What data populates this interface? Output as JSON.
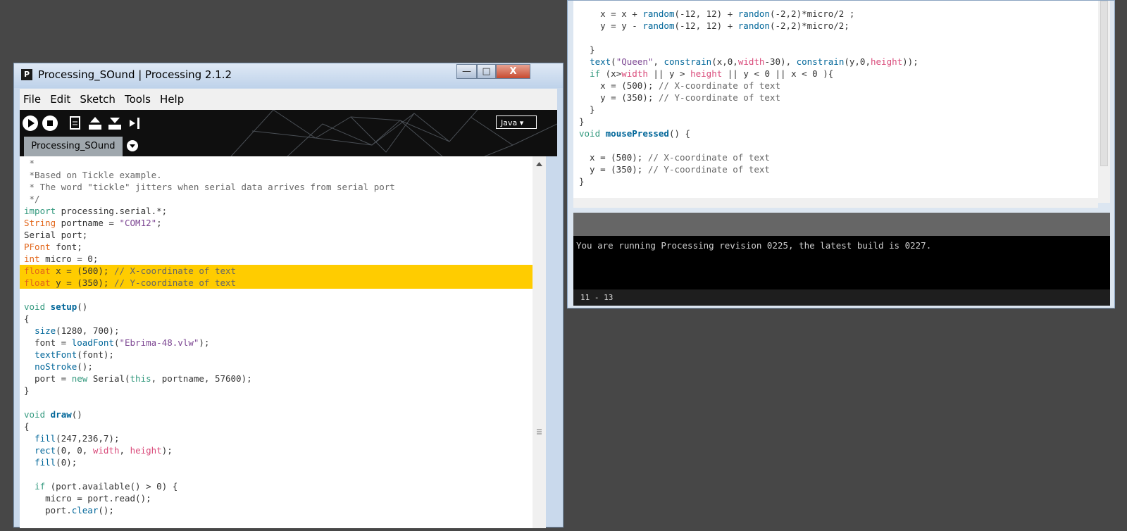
{
  "right_window": {
    "code_lines": [
      "    x = x + random(-12, 12) + randon(-2,2)*micro/2 ;",
      "    y = y - random(-12, 12) + randon(-2,2)*micro/2;",
      "",
      "  }",
      "  text(\"Queen\", constrain(x,0,width-30), constrain(y,0,height));",
      "  if (x>width || y > height || y < 0 || x < 0 ){",
      "    x = (500); // X-coordinate of text",
      "    y = (350); // Y-coordinate of text",
      "  }",
      "}",
      "void mousePressed() {",
      "",
      "  x = (500); // X-coordinate of text",
      "  y = (350); // Y-coordinate of text",
      "}"
    ],
    "console_message": "You are running Processing revision 0225, the latest build is 0227.",
    "status_text": "11 - 13"
  },
  "left_window": {
    "title": "Processing_SOund | Processing 2.1.2",
    "app_icon_letter": "P",
    "window_buttons": {
      "minimize": "—",
      "maximize": "□",
      "close": "X"
    },
    "menu": [
      "File",
      "Edit",
      "Sketch",
      "Tools",
      "Help"
    ],
    "toolbar_icons": [
      "run-icon",
      "stop-icon",
      "new-icon",
      "open-icon",
      "save-icon",
      "export-icon"
    ],
    "mode_label": "Java ▾",
    "tab_label": "Processing_SOund",
    "code_lines": [
      " *",
      " *Based on Tickle example.",
      " * The word \"tickle\" jitters when serial data arrives from serial port",
      " */",
      "import processing.serial.*;",
      "String portname = \"COM12\";",
      "Serial port;",
      "PFont font;",
      "int micro = 0;",
      "float x = (500); // X-coordinate of text",
      "float y = (350); // Y-coordinate of text",
      "",
      "void setup()",
      "{",
      "  size(1280, 700);",
      "  font = loadFont(\"Ebrima-48.vlw\");",
      "  textFont(font);",
      "  noStroke();",
      "  port = new Serial(this, portname, 57600);",
      "}",
      "",
      "void draw()",
      "{",
      "  fill(247,236,7);",
      "  rect(0, 0, width, height);",
      "  fill(0);",
      "",
      "  if (port.available() > 0) {",
      "    micro = port.read();",
      "    port.clear();"
    ]
  },
  "colors": {
    "desktop": "#474747",
    "highlight": "#ffcc00",
    "console_bg": "#000000",
    "close_button": "#c74b30"
  }
}
